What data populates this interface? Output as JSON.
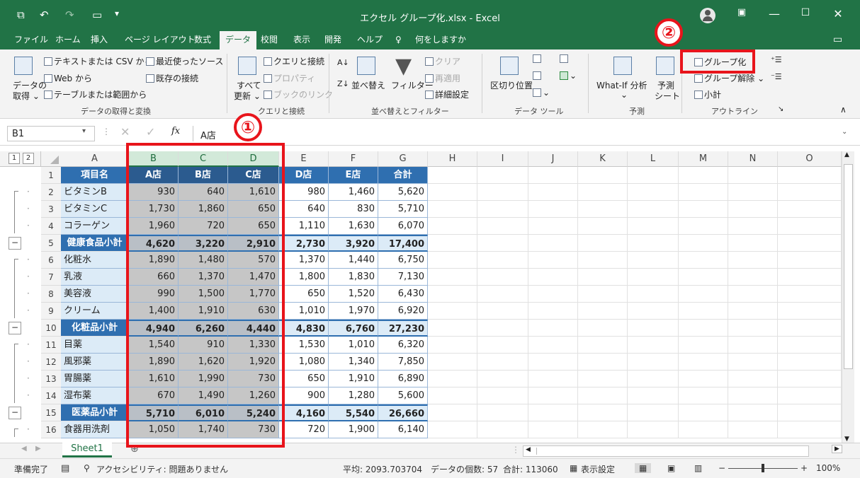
{
  "title": "エクセル グループ化.xlsx  -  Excel",
  "menu_tabs": [
    "ファイル",
    "ホーム",
    "挿入",
    "ページ レイアウト",
    "数式",
    "データ",
    "校閲",
    "表示",
    "開発",
    "ヘルプ",
    "何をしますか"
  ],
  "ribbon": {
    "get_data_l1": "データの",
    "get_data_l2": "取得 ⌄",
    "from_text_csv": "テキストまたは CSV から",
    "from_web": "Web から",
    "from_table": "テーブルまたは範囲から",
    "recent_sources": "最近使ったソース",
    "existing_connections": "既存の接続",
    "group_get": "データの取得と変換",
    "refresh_l1": "すべて",
    "refresh_l2": "更新 ⌄",
    "queries_connections": "クエリと接続",
    "properties": "プロパティ",
    "workbook_links": "ブックのリンク",
    "group_queries": "クエリと接続",
    "sort": "並べ替え",
    "filter": "フィルター",
    "clear": "クリア",
    "reapply": "再適用",
    "advanced": "詳細設定",
    "group_sort": "並べ替えとフィルター",
    "text_to_columns": "区切り位置",
    "group_datatools": "データ ツール",
    "whatif": "What-If 分析",
    "forecast_l1": "予測",
    "forecast_l2": "シート",
    "group_forecast": "予測",
    "group": "グループ化",
    "ungroup": "グループ解除",
    "subtotal": "小計",
    "group_outline": "アウトライン"
  },
  "formula_bar": {
    "name_box": "B1",
    "formula": "A店"
  },
  "columns": [
    "A",
    "B",
    "C",
    "D",
    "E",
    "F",
    "G",
    "H",
    "I",
    "J",
    "K",
    "L",
    "M",
    "N",
    "O"
  ],
  "outline_levels": [
    "1",
    "2"
  ],
  "rows": [
    {
      "n": "1",
      "cells": [
        "項目名",
        "A店",
        "B店",
        "C店",
        "D店",
        "E店",
        "合計"
      ],
      "kind": "header"
    },
    {
      "n": "2",
      "cells": [
        "ビタミンB",
        "930",
        "640",
        "1,610",
        "980",
        "1,460",
        "5,620"
      ],
      "kind": "data"
    },
    {
      "n": "3",
      "cells": [
        "ビタミンC",
        "1,730",
        "1,860",
        "650",
        "640",
        "830",
        "5,710"
      ],
      "kind": "data"
    },
    {
      "n": "4",
      "cells": [
        "コラーゲン",
        "1,960",
        "720",
        "650",
        "1,110",
        "1,630",
        "6,070"
      ],
      "kind": "data"
    },
    {
      "n": "5",
      "cells": [
        "健康食品小計",
        "4,620",
        "3,220",
        "2,910",
        "2,730",
        "3,920",
        "17,400"
      ],
      "kind": "sub"
    },
    {
      "n": "6",
      "cells": [
        "化粧水",
        "1,890",
        "1,480",
        "570",
        "1,370",
        "1,440",
        "6,750"
      ],
      "kind": "data"
    },
    {
      "n": "7",
      "cells": [
        "乳液",
        "660",
        "1,370",
        "1,470",
        "1,800",
        "1,830",
        "7,130"
      ],
      "kind": "data"
    },
    {
      "n": "8",
      "cells": [
        "美容液",
        "990",
        "1,500",
        "1,770",
        "650",
        "1,520",
        "6,430"
      ],
      "kind": "data"
    },
    {
      "n": "9",
      "cells": [
        "クリーム",
        "1,400",
        "1,910",
        "630",
        "1,010",
        "1,970",
        "6,920"
      ],
      "kind": "data"
    },
    {
      "n": "10",
      "cells": [
        "化粧品小計",
        "4,940",
        "6,260",
        "4,440",
        "4,830",
        "6,760",
        "27,230"
      ],
      "kind": "sub"
    },
    {
      "n": "11",
      "cells": [
        "目薬",
        "1,540",
        "910",
        "1,330",
        "1,530",
        "1,010",
        "6,320"
      ],
      "kind": "data"
    },
    {
      "n": "12",
      "cells": [
        "風邪薬",
        "1,890",
        "1,620",
        "1,920",
        "1,080",
        "1,340",
        "7,850"
      ],
      "kind": "data"
    },
    {
      "n": "13",
      "cells": [
        "胃腸薬",
        "1,610",
        "1,990",
        "730",
        "650",
        "1,910",
        "6,890"
      ],
      "kind": "data"
    },
    {
      "n": "14",
      "cells": [
        "湿布薬",
        "670",
        "1,490",
        "1,260",
        "900",
        "1,280",
        "5,600"
      ],
      "kind": "data"
    },
    {
      "n": "15",
      "cells": [
        "医薬品小計",
        "5,710",
        "6,010",
        "5,240",
        "4,160",
        "5,540",
        "26,660"
      ],
      "kind": "sub"
    },
    {
      "n": "16",
      "cells": [
        "食器用洗剤",
        "1,050",
        "1,740",
        "730",
        "720",
        "1,900",
        "6,140"
      ],
      "kind": "data"
    }
  ],
  "sheet_tab": "Sheet1",
  "status": {
    "ready": "準備完了",
    "accessibility": "アクセシビリティ: 問題ありません",
    "average": "平均: 2093.703704",
    "count": "データの個数: 57",
    "sum": "合計: 113060",
    "display_settings": "表示設定",
    "zoom": "100%"
  },
  "annotations": {
    "step1": "①",
    "step2": "②"
  },
  "colors": {
    "excel_green": "#217346",
    "header_blue": "#2f6fb0",
    "name_fill": "#dcebf7",
    "annotation_red": "#e8141b"
  }
}
